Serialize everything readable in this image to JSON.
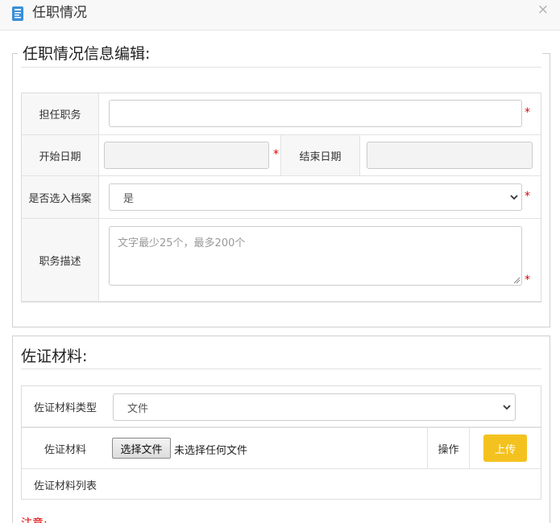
{
  "window": {
    "title": "任职情况",
    "close_label": "×"
  },
  "section1": {
    "legend": "任职情况信息编辑:",
    "position_label": "担任职务",
    "position_value": "",
    "start_date_label": "开始日期",
    "start_date_value": "",
    "end_date_label": "结束日期",
    "end_date_value": "",
    "archive_label": "是否选入档案",
    "archive_value": "是",
    "description_label": "职务描述",
    "description_placeholder": "文字最少25个，最多200个",
    "required_mark": "*"
  },
  "section2": {
    "heading": "佐证材料:",
    "material_type_label": "佐证材料类型",
    "material_type_value": "文件",
    "material_label": "佐证材料",
    "choose_file_label": "选择文件",
    "no_file_text": "未选择任何文件",
    "action_label": "操作",
    "upload_label": "上传",
    "list_label": "佐证材料列表"
  },
  "notice": "注意:",
  "colors": {
    "accent_yellow": "#f4c21f",
    "required_red": "#e00000",
    "icon_blue": "#3a8fd8"
  }
}
